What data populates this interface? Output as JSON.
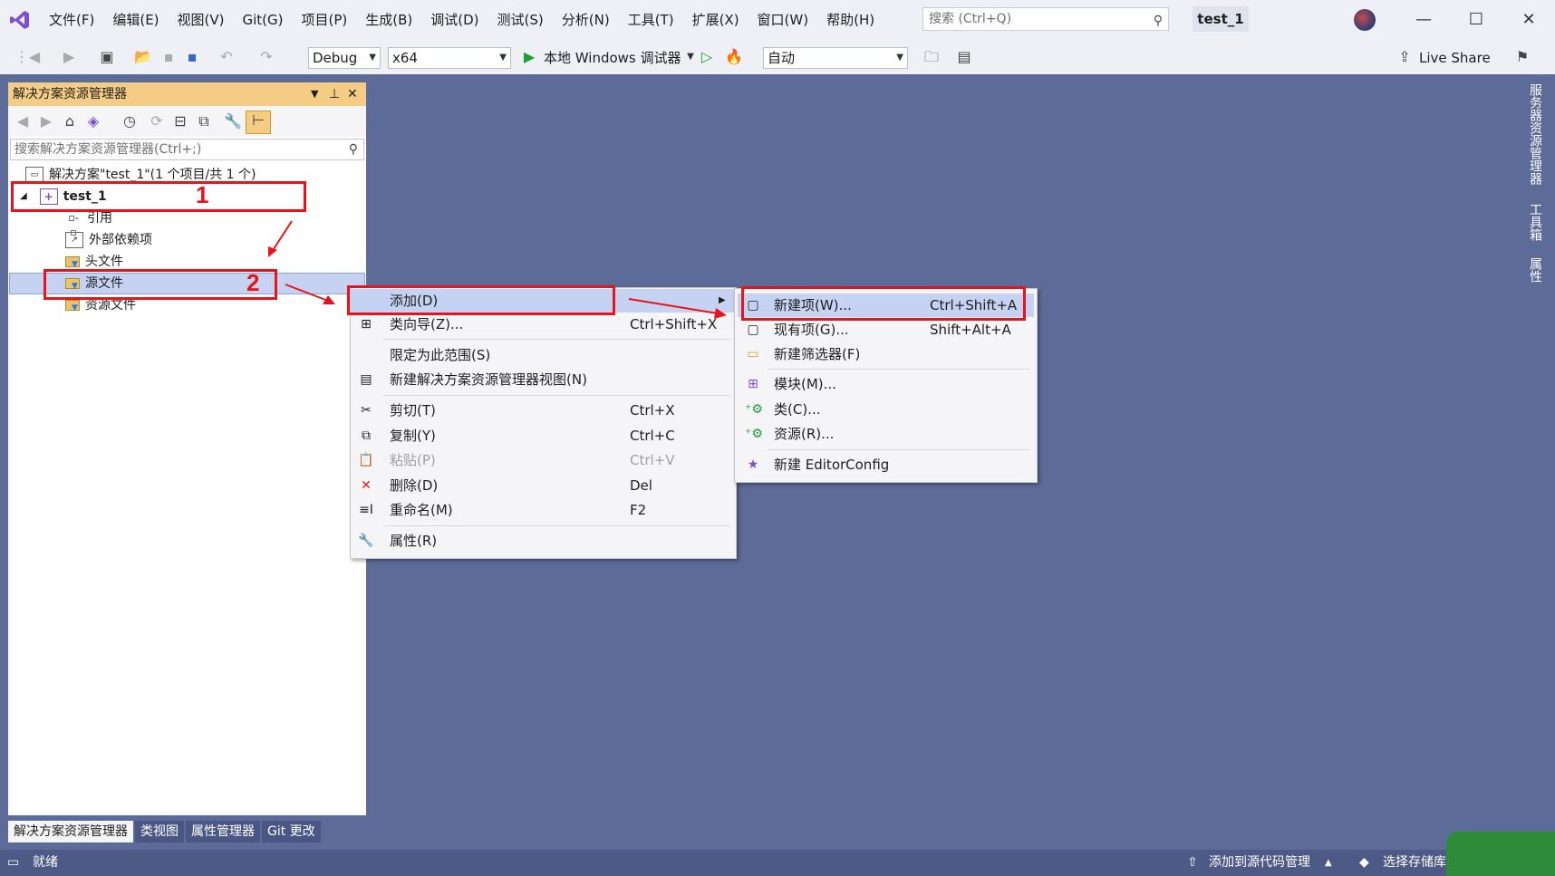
{
  "menu": [
    "文件(F)",
    "编辑(E)",
    "视图(V)",
    "Git(G)",
    "项目(P)",
    "生成(B)",
    "调试(D)",
    "测试(S)",
    "分析(N)",
    "工具(T)",
    "扩展(X)",
    "窗口(W)",
    "帮助(H)"
  ],
  "search": {
    "placeholder": "搜索 (Ctrl+Q)"
  },
  "solution_tab": "test_1",
  "toolbar": {
    "config": "Debug",
    "platform": "x64",
    "debugger": "本地 Windows 调试器",
    "auto": "自动",
    "live_share": "Live Share"
  },
  "solution_explorer": {
    "title": "解决方案资源管理器",
    "search_placeholder": "搜索解决方案资源管理器(Ctrl+;)",
    "solution_line": "解决方案\"test_1\"(1 个项目/共 1 个)",
    "project": "test_1",
    "items": [
      "引用",
      "外部依赖项",
      "头文件",
      "源文件",
      "资源文件"
    ],
    "bottom_tabs": [
      "解决方案资源管理器",
      "类视图",
      "属性管理器",
      "Git 更改"
    ]
  },
  "right_panel": [
    "服务器资源管理器",
    "工具箱",
    "属性"
  ],
  "context_menu": [
    {
      "label": "添加(D)",
      "shortcut": "",
      "icon": "none",
      "submenu": true
    },
    {
      "label": "类向导(Z)...",
      "shortcut": "Ctrl+Shift+X",
      "icon": "class-wizard-icon"
    },
    {
      "label": "限定为此范围(S)",
      "shortcut": "",
      "icon": "none"
    },
    {
      "label": "新建解决方案资源管理器视图(N)",
      "shortcut": "",
      "icon": "new-view-icon"
    },
    {
      "label": "剪切(T)",
      "shortcut": "Ctrl+X",
      "icon": "cut-icon"
    },
    {
      "label": "复制(Y)",
      "shortcut": "Ctrl+C",
      "icon": "copy-icon"
    },
    {
      "label": "粘贴(P)",
      "shortcut": "Ctrl+V",
      "icon": "paste-icon",
      "disabled": true
    },
    {
      "label": "删除(D)",
      "shortcut": "Del",
      "icon": "delete-icon"
    },
    {
      "label": "重命名(M)",
      "shortcut": "F2",
      "icon": "rename-icon"
    },
    {
      "label": "属性(R)",
      "shortcut": "",
      "icon": "wrench-icon"
    }
  ],
  "submenu": [
    {
      "label": "新建项(W)...",
      "shortcut": "Ctrl+Shift+A",
      "icon": "new-item-icon"
    },
    {
      "label": "现有项(G)...",
      "shortcut": "Shift+Alt+A",
      "icon": "existing-item-icon"
    },
    {
      "label": "新建筛选器(F)",
      "shortcut": "",
      "icon": "new-filter-icon"
    },
    {
      "label": "模块(M)...",
      "shortcut": "",
      "icon": "module-icon"
    },
    {
      "label": "类(C)...",
      "shortcut": "",
      "icon": "class-icon"
    },
    {
      "label": "资源(R)...",
      "shortcut": "",
      "icon": "resource-icon"
    },
    {
      "label": "新建 EditorConfig",
      "shortcut": "",
      "icon": "editorconfig-icon"
    }
  ],
  "status": {
    "ready": "就绪",
    "add_to_source": "添加到源代码管理",
    "select_repo": "选择存储库"
  },
  "annotations": {
    "step1": "1",
    "step2": "2"
  },
  "colors": {
    "accent": "#5d6b99",
    "highlight": "#c5d2f2",
    "annotation": "#e8141b",
    "vs_purple": "#7d4fd2"
  }
}
